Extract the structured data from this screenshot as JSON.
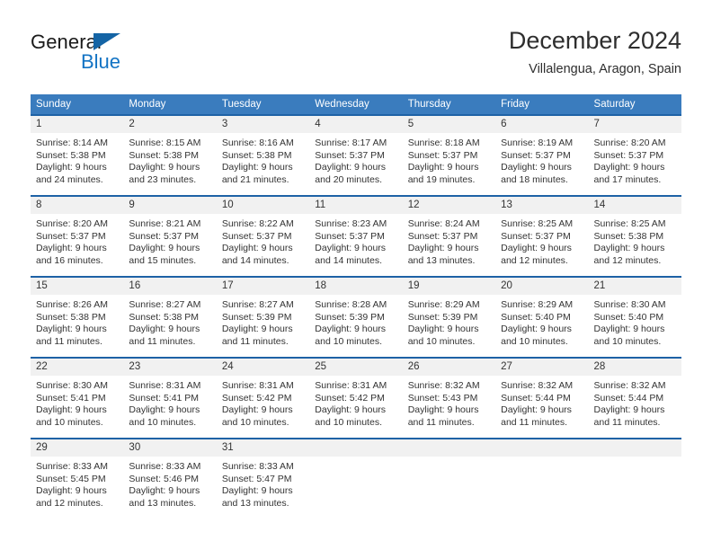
{
  "logo": {
    "word1": "General",
    "word2": "Blue",
    "triangle_color": "#1464a5",
    "blue_color": "#1273c4"
  },
  "header": {
    "title": "December 2024",
    "subtitle": "Villalengua, Aragon, Spain"
  },
  "theme": {
    "header_bar": "#3a7cbe",
    "row_rule": "#1e62a6",
    "daynum_bg": "#f1f1f1",
    "text": "#333333"
  },
  "weekdays": [
    "Sunday",
    "Monday",
    "Tuesday",
    "Wednesday",
    "Thursday",
    "Friday",
    "Saturday"
  ],
  "weeks": [
    [
      {
        "day": "1",
        "lines": [
          "Sunrise: 8:14 AM",
          "Sunset: 5:38 PM",
          "Daylight: 9 hours",
          "and 24 minutes."
        ]
      },
      {
        "day": "2",
        "lines": [
          "Sunrise: 8:15 AM",
          "Sunset: 5:38 PM",
          "Daylight: 9 hours",
          "and 23 minutes."
        ]
      },
      {
        "day": "3",
        "lines": [
          "Sunrise: 8:16 AM",
          "Sunset: 5:38 PM",
          "Daylight: 9 hours",
          "and 21 minutes."
        ]
      },
      {
        "day": "4",
        "lines": [
          "Sunrise: 8:17 AM",
          "Sunset: 5:37 PM",
          "Daylight: 9 hours",
          "and 20 minutes."
        ]
      },
      {
        "day": "5",
        "lines": [
          "Sunrise: 8:18 AM",
          "Sunset: 5:37 PM",
          "Daylight: 9 hours",
          "and 19 minutes."
        ]
      },
      {
        "day": "6",
        "lines": [
          "Sunrise: 8:19 AM",
          "Sunset: 5:37 PM",
          "Daylight: 9 hours",
          "and 18 minutes."
        ]
      },
      {
        "day": "7",
        "lines": [
          "Sunrise: 8:20 AM",
          "Sunset: 5:37 PM",
          "Daylight: 9 hours",
          "and 17 minutes."
        ]
      }
    ],
    [
      {
        "day": "8",
        "lines": [
          "Sunrise: 8:20 AM",
          "Sunset: 5:37 PM",
          "Daylight: 9 hours",
          "and 16 minutes."
        ]
      },
      {
        "day": "9",
        "lines": [
          "Sunrise: 8:21 AM",
          "Sunset: 5:37 PM",
          "Daylight: 9 hours",
          "and 15 minutes."
        ]
      },
      {
        "day": "10",
        "lines": [
          "Sunrise: 8:22 AM",
          "Sunset: 5:37 PM",
          "Daylight: 9 hours",
          "and 14 minutes."
        ]
      },
      {
        "day": "11",
        "lines": [
          "Sunrise: 8:23 AM",
          "Sunset: 5:37 PM",
          "Daylight: 9 hours",
          "and 14 minutes."
        ]
      },
      {
        "day": "12",
        "lines": [
          "Sunrise: 8:24 AM",
          "Sunset: 5:37 PM",
          "Daylight: 9 hours",
          "and 13 minutes."
        ]
      },
      {
        "day": "13",
        "lines": [
          "Sunrise: 8:25 AM",
          "Sunset: 5:37 PM",
          "Daylight: 9 hours",
          "and 12 minutes."
        ]
      },
      {
        "day": "14",
        "lines": [
          "Sunrise: 8:25 AM",
          "Sunset: 5:38 PM",
          "Daylight: 9 hours",
          "and 12 minutes."
        ]
      }
    ],
    [
      {
        "day": "15",
        "lines": [
          "Sunrise: 8:26 AM",
          "Sunset: 5:38 PM",
          "Daylight: 9 hours",
          "and 11 minutes."
        ]
      },
      {
        "day": "16",
        "lines": [
          "Sunrise: 8:27 AM",
          "Sunset: 5:38 PM",
          "Daylight: 9 hours",
          "and 11 minutes."
        ]
      },
      {
        "day": "17",
        "lines": [
          "Sunrise: 8:27 AM",
          "Sunset: 5:39 PM",
          "Daylight: 9 hours",
          "and 11 minutes."
        ]
      },
      {
        "day": "18",
        "lines": [
          "Sunrise: 8:28 AM",
          "Sunset: 5:39 PM",
          "Daylight: 9 hours",
          "and 10 minutes."
        ]
      },
      {
        "day": "19",
        "lines": [
          "Sunrise: 8:29 AM",
          "Sunset: 5:39 PM",
          "Daylight: 9 hours",
          "and 10 minutes."
        ]
      },
      {
        "day": "20",
        "lines": [
          "Sunrise: 8:29 AM",
          "Sunset: 5:40 PM",
          "Daylight: 9 hours",
          "and 10 minutes."
        ]
      },
      {
        "day": "21",
        "lines": [
          "Sunrise: 8:30 AM",
          "Sunset: 5:40 PM",
          "Daylight: 9 hours",
          "and 10 minutes."
        ]
      }
    ],
    [
      {
        "day": "22",
        "lines": [
          "Sunrise: 8:30 AM",
          "Sunset: 5:41 PM",
          "Daylight: 9 hours",
          "and 10 minutes."
        ]
      },
      {
        "day": "23",
        "lines": [
          "Sunrise: 8:31 AM",
          "Sunset: 5:41 PM",
          "Daylight: 9 hours",
          "and 10 minutes."
        ]
      },
      {
        "day": "24",
        "lines": [
          "Sunrise: 8:31 AM",
          "Sunset: 5:42 PM",
          "Daylight: 9 hours",
          "and 10 minutes."
        ]
      },
      {
        "day": "25",
        "lines": [
          "Sunrise: 8:31 AM",
          "Sunset: 5:42 PM",
          "Daylight: 9 hours",
          "and 10 minutes."
        ]
      },
      {
        "day": "26",
        "lines": [
          "Sunrise: 8:32 AM",
          "Sunset: 5:43 PM",
          "Daylight: 9 hours",
          "and 11 minutes."
        ]
      },
      {
        "day": "27",
        "lines": [
          "Sunrise: 8:32 AM",
          "Sunset: 5:44 PM",
          "Daylight: 9 hours",
          "and 11 minutes."
        ]
      },
      {
        "day": "28",
        "lines": [
          "Sunrise: 8:32 AM",
          "Sunset: 5:44 PM",
          "Daylight: 9 hours",
          "and 11 minutes."
        ]
      }
    ],
    [
      {
        "day": "29",
        "lines": [
          "Sunrise: 8:33 AM",
          "Sunset: 5:45 PM",
          "Daylight: 9 hours",
          "and 12 minutes."
        ]
      },
      {
        "day": "30",
        "lines": [
          "Sunrise: 8:33 AM",
          "Sunset: 5:46 PM",
          "Daylight: 9 hours",
          "and 13 minutes."
        ]
      },
      {
        "day": "31",
        "lines": [
          "Sunrise: 8:33 AM",
          "Sunset: 5:47 PM",
          "Daylight: 9 hours",
          "and 13 minutes."
        ]
      },
      {
        "day": "",
        "lines": []
      },
      {
        "day": "",
        "lines": []
      },
      {
        "day": "",
        "lines": []
      },
      {
        "day": "",
        "lines": []
      }
    ]
  ]
}
